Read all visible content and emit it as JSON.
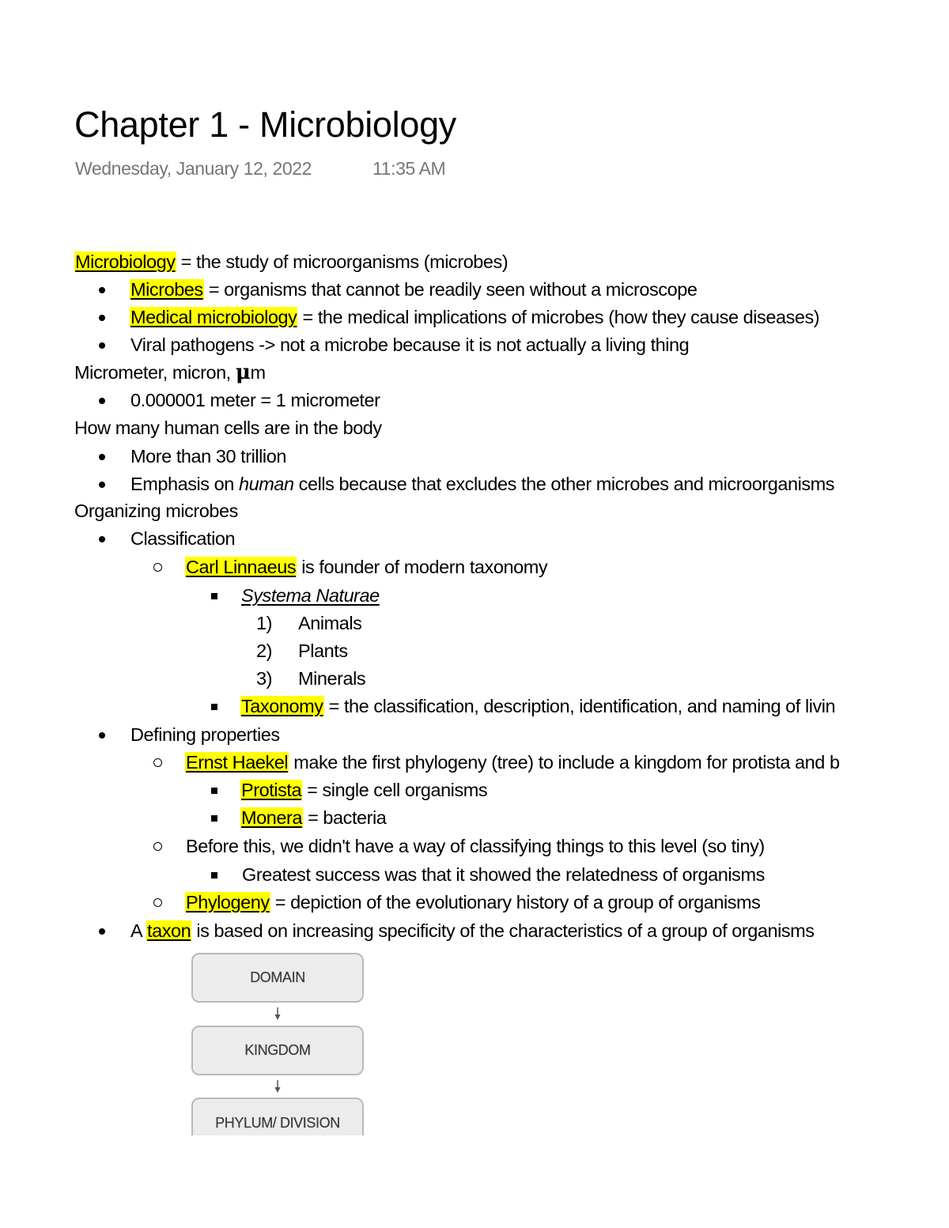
{
  "header": {
    "title": "Chapter 1 - Microbiology",
    "date": "Wednesday, January 12, 2022",
    "time": "11:35 AM"
  },
  "notes": {
    "l1": {
      "term": "Microbiology",
      "rest": " = the study of microorganisms (microbes)"
    },
    "l2": {
      "term": "Microbes",
      "rest": " = organisms that cannot be readily seen without a microscope"
    },
    "l3": {
      "term": "Medical microbiology",
      "rest": " = the medical implications of microbes (how they cause diseases)"
    },
    "l4": {
      "text": "Viral pathogens -> not a microbe because it is not actually a living thing"
    },
    "l5": {
      "text": "Micrometer, micron, ",
      "symbol": "μ",
      "suffix": "m"
    },
    "l6": {
      "text": "0.000001 meter = 1 micrometer"
    },
    "l7": {
      "text": "How many human cells are in the body"
    },
    "l8": {
      "text": "More than 30 trillion"
    },
    "l9": {
      "pre": "Emphasis on ",
      "em": "human",
      "post": " cells because that excludes the other microbes and microorganisms"
    },
    "l10": {
      "text": "Organizing microbes"
    },
    "l11": {
      "text": "Classification"
    },
    "l12": {
      "term": "Carl Linnaeus",
      "rest": " is founder of modern taxonomy"
    },
    "l13": {
      "text": "Systema Naturae"
    },
    "l14": {
      "num": "1)",
      "text": "Animals"
    },
    "l15": {
      "num": "2)",
      "text": "Plants"
    },
    "l16": {
      "num": "3)",
      "text": "Minerals"
    },
    "l17": {
      "term": "Taxonomy",
      "rest": " = the classification, description, identification, and naming of livin"
    },
    "l18": {
      "text": "Defining properties"
    },
    "l19": {
      "term": "Ernst Haekel",
      "rest": " make the first phylogeny (tree) to include a kingdom for protista and b"
    },
    "l20": {
      "term": "Protista",
      "rest": " = single cell organisms"
    },
    "l21": {
      "term": "Monera",
      "rest": " = bacteria"
    },
    "l22": {
      "text": "Before this, we didn't have a way of classifying things to this level (so tiny)"
    },
    "l23": {
      "text": "Greatest success was that it showed the relatedness of organisms"
    },
    "l24": {
      "term": "Phylogeny",
      "rest": " = depiction of the evolutionary history of a group of organisms"
    },
    "l25": {
      "pre": "A ",
      "term": "taxon",
      "rest": " is based on increasing specificity of the characteristics of a group of organisms"
    }
  },
  "diagram": {
    "boxes": [
      "DOMAIN",
      "KINGDOM",
      "PHYLUM/ DIVISION"
    ],
    "arrow_icon": "down-arrow"
  },
  "colors": {
    "highlight": "#ffff00",
    "meta_text": "#767676",
    "box_fill": "#ececec",
    "box_border": "#b9b9b9"
  }
}
